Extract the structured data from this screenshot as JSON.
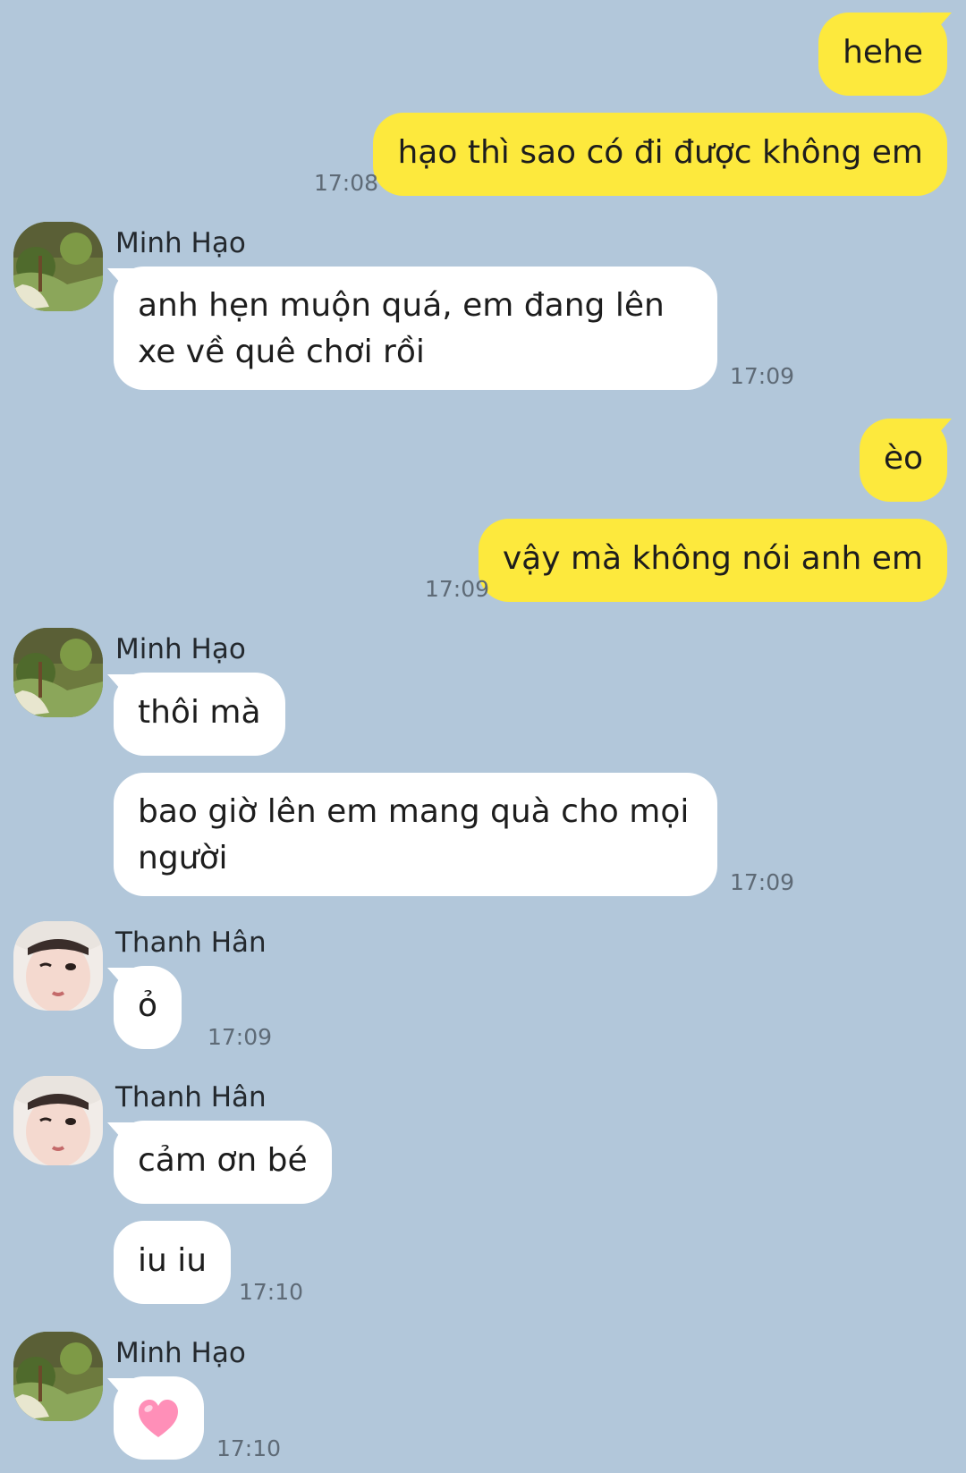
{
  "chat": {
    "messages": {
      "m1": {
        "text": "hehe"
      },
      "m2": {
        "text": "hạo thì sao có đi được không em",
        "time": "17:08"
      },
      "m3": {
        "sender": "Minh Hạo",
        "text": "anh hẹn muộn quá, em đang lên xe về quê chơi rồi",
        "time": "17:09"
      },
      "m4": {
        "text": "èo"
      },
      "m5": {
        "text": "vậy mà không nói anh em",
        "time": "17:09"
      },
      "m6": {
        "sender": "Minh Hạo",
        "text": "thôi mà"
      },
      "m7": {
        "text": "bao giờ lên em mang quà cho mọi người",
        "time": "17:09"
      },
      "m8": {
        "sender": "Thanh Hân",
        "text": "ỏ",
        "time": "17:09"
      },
      "m9": {
        "sender": "Thanh Hân",
        "text": "cảm ơn bé"
      },
      "m10": {
        "text": "iu iu",
        "time": "17:10"
      },
      "m11": {
        "sender": "Minh Hạo",
        "emoji": "pink-heart",
        "time": "17:10"
      }
    }
  },
  "colors": {
    "background": "#b2c7da",
    "my_bubble": "#fde93d",
    "their_bubble": "#ffffff",
    "heart": "#ff8fb8"
  }
}
